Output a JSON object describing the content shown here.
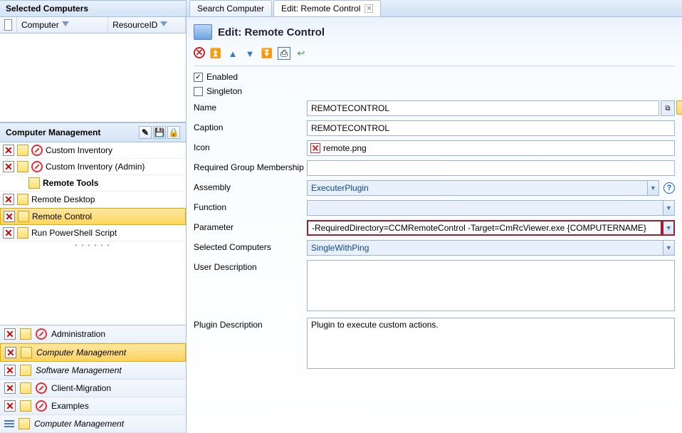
{
  "left": {
    "selected_title": "Selected Computers",
    "cols": {
      "computer": "Computer",
      "resource": "ResourceID"
    },
    "cm_title": "Computer Management",
    "tree": {
      "custom_inv": "Custom Inventory",
      "custom_inv_admin": "Custom Inventory (Admin)",
      "remote_tools": "Remote Tools",
      "remote_desktop": "Remote Desktop",
      "remote_control": "Remote Control",
      "run_ps": "Run PowerShell Script"
    },
    "nav": {
      "admin": "Administration",
      "cm": "Computer Management",
      "sm": "Software Management",
      "migr": "Client-Migration",
      "ex": "Examples",
      "cm2": "Computer Management"
    }
  },
  "tabs": {
    "search": "Search Computer",
    "edit": "Edit: Remote Control"
  },
  "title": "Edit: Remote Control",
  "chk": {
    "enabled": "Enabled",
    "singleton": "Singleton"
  },
  "labels": {
    "name": "Name",
    "caption": "Caption",
    "icon": "Icon",
    "rgm": "Required Group Membership",
    "assembly": "Assembly",
    "function": "Function",
    "parameter": "Parameter",
    "selcomp": "Selected Computers",
    "udesc": "User Description",
    "pdesc": "Plugin Description"
  },
  "values": {
    "name": "REMOTECONTROL",
    "caption": "REMOTECONTROL",
    "icon": "remote.png",
    "rgm": "",
    "assembly": "ExecuterPlugin",
    "function": "",
    "parameter": "-RequiredDirectory=CCMRemoteControl -Target=CmRcViewer.exe {COMPUTERNAME}",
    "selcomp": "SingleWithPing",
    "udesc": "",
    "pdesc": "Plugin to execute custom actions."
  }
}
